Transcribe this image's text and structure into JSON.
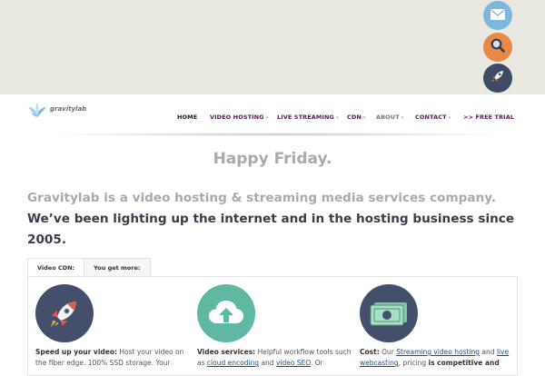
{
  "floating_actions": {
    "items": [
      {
        "icon": "envelope-icon",
        "color": "#7fb6dc"
      },
      {
        "icon": "search-icon",
        "color": "#e8894a"
      },
      {
        "icon": "rocket-icon",
        "color": "#3d4b66"
      }
    ]
  },
  "header": {
    "logo_text": "gravitylab",
    "nav": {
      "home": "HOME",
      "video_hosting": "VIDEO HOSTING",
      "live_streaming": "LIVE STREAMING",
      "cdn": "CDN",
      "about": "ABOUT",
      "contact": "CONTACT",
      "free_trial": ">> FREE TRIAL",
      "caret": "▾"
    }
  },
  "greeting": "Happy Friday.",
  "intro": {
    "part1": "Gravitylab is a video hosting & streaming media services company.",
    "part2": "We’ve been lighting up the internet and in the hosting business since 2005."
  },
  "tabs": [
    {
      "label": "Video CDN:"
    },
    {
      "label": "You get more:"
    }
  ],
  "features": [
    {
      "icon": "rocket-icon",
      "title": "Speed up your video:",
      "text1": "Host your video on the fiber edge. 100% SSD storage. Your"
    },
    {
      "icon": "cloud-upload-icon",
      "title": "Video services:",
      "text1": "Helpful workflow tools such as",
      "link1": "cloud encoding",
      "text2": "and",
      "link2": "video SEO",
      "text3": ". Or"
    },
    {
      "icon": "money-icon",
      "title": "Cost:",
      "text1": "Our",
      "link1": "Streaming video hosting",
      "text2": "and",
      "link2": "live webcasting",
      "text3": "pricing",
      "bold": "is competitive and"
    }
  ],
  "colors": {
    "nav": "#5a1856",
    "muted_text": "#aaaaaa",
    "strong_text": "#3b3b4a",
    "top_band": "#e9e8e1",
    "link": "#1a4f86"
  }
}
